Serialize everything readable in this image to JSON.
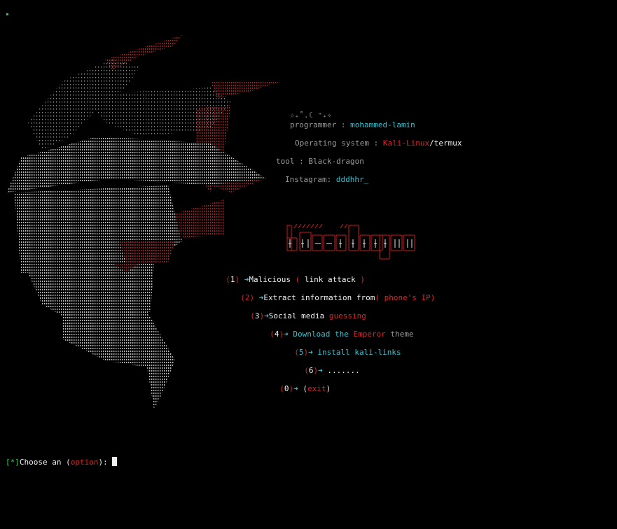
{
  "header": {
    "emblem": "☆₊˚.☾ ⁺₊✧",
    "programmer_label": "programmer : ",
    "programmer_value": "mohammed-lamin",
    "os_label": "Operating system : ",
    "os_value_red": "Kali-Linux",
    "os_sep": "/",
    "os_value_white": "termux",
    "tool_label": "tool : Black-dragon",
    "instagram_label": "Instagram: ",
    "instagram_value": "dddhhr_"
  },
  "logo_text": "black-dragon",
  "menu": [
    {
      "pre": "(",
      "num": "1",
      "post": ") ",
      "arrow": "➜",
      "text_white": "Malicious ",
      "text_red": "( ",
      "text_white2": "link attack ",
      "text_red2": ")"
    },
    {
      "pre": "(",
      "num": "2",
      "post": ") ",
      "arrow": "➜",
      "text_white": "Extract information from",
      "text_red": "( phone's IP)"
    },
    {
      "pre": "(",
      "num": "3",
      "post": ")",
      "arrow": "➜",
      "text_white": "Social media ",
      "text_red": "guessing"
    },
    {
      "pre": "(",
      "num": "4",
      "post": ")",
      "arrow": "➜",
      "text_cyan": " Download the ",
      "text_red": "Emperor",
      "text_muted": " theme"
    },
    {
      "pre": "(",
      "num": "5",
      "post": ")",
      "arrow": "➜",
      "text_cyan": " install kali-links"
    },
    {
      "pre": "(",
      "num": "6",
      "post": ")",
      "arrow": "➜",
      "text_white": " ......."
    },
    {
      "pre": "(",
      "num": "0",
      "post": ")",
      "arrow": "➜",
      "text_white": " (",
      "text_red": "exit",
      "text_white2": ")"
    }
  ],
  "prompt": {
    "marker": "[*]",
    "text": "Choose an (",
    "option": "option",
    "end": "): "
  },
  "colors": {
    "background": "#000000",
    "cyan": "#2ec7d6",
    "red": "#d32626",
    "green": "#2fcf4e"
  }
}
